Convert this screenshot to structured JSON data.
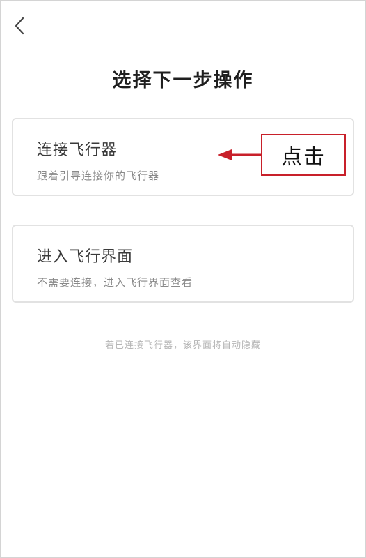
{
  "page": {
    "title": "选择下一步操作",
    "hint": "若已连接飞行器，该界面将自动隐藏"
  },
  "options": [
    {
      "title": "连接飞行器",
      "subtitle": "跟着引导连接你的飞行器"
    },
    {
      "title": "进入飞行界面",
      "subtitle": "不需要连接，进入飞行界面查看"
    }
  ],
  "annotation": {
    "label": "点击",
    "color": "#c8202a"
  },
  "icons": {
    "back": "chevron-left-icon",
    "arrow": "arrow-left-icon"
  }
}
